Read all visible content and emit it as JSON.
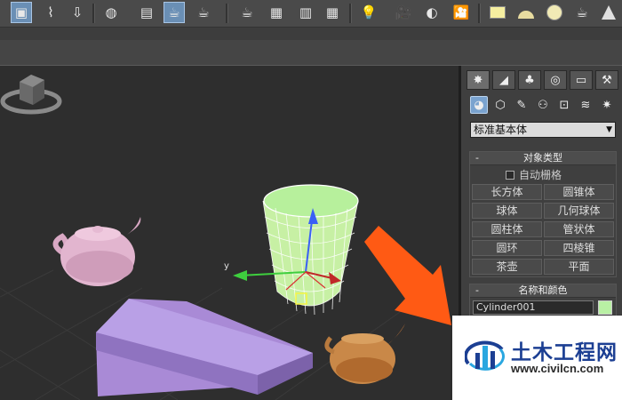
{
  "toolbar": {
    "icons": [
      "select-object-icon",
      "curve-editor-icon",
      "render-setup-icon",
      "material-editor-icon",
      "render-frame-icon",
      "teapot-render-icon",
      "teapot-active-icon",
      "teapot-production-icon",
      "environment-icon",
      "effects-icon",
      "schematic-icon",
      "layout-icon",
      "light-bulb-icon",
      "camera-icon",
      "sphere-shade-icon",
      "movie-camera-icon",
      "box-icon",
      "dome-icon",
      "disc-icon",
      "teapot-icon",
      "cone-icon"
    ]
  },
  "command_panel": {
    "tabs": [
      "create-tab",
      "modify-tab",
      "hierarchy-tab",
      "motion-tab",
      "display-tab",
      "utilities-tab"
    ],
    "subtabs": [
      "geometry",
      "shapes",
      "lights",
      "cameras",
      "helpers",
      "space-warps",
      "systems"
    ],
    "dropdown_value": "标准基本体",
    "object_type": {
      "title": "对象类型",
      "collapse": "-",
      "autogrid_label": "自动栅格",
      "buttons": [
        "长方体",
        "圆锥体",
        "球体",
        "几何球体",
        "圆柱体",
        "管状体",
        "圆环",
        "四棱锥",
        "茶壶",
        "平面"
      ]
    },
    "name_color": {
      "title": "名称和颜色",
      "collapse": "-",
      "name_value": "Cylinder001",
      "color": "#b9f0a4"
    }
  },
  "viewport": {
    "axis_labels": {
      "y": "y"
    },
    "objects": [
      "teapot-pink",
      "cylinder-green",
      "box-purple",
      "teapot-orange"
    ]
  },
  "watermark": {
    "title": "土木工程网",
    "url": "www.civilcn.com"
  },
  "colors": {
    "accent": "#6a8fb5",
    "arrow": "#ff5a14",
    "wm_blue": "#1c3f93"
  }
}
